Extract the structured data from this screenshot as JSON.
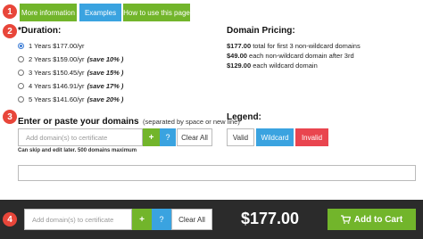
{
  "steps": [
    "1",
    "2",
    "3",
    "4"
  ],
  "top_buttons": {
    "more_info": "More information",
    "examples": "Examples",
    "how_to": "How to use this page"
  },
  "duration": {
    "title": "*Duration:",
    "options": [
      {
        "label": "1 Years $177.00/yr",
        "save": "",
        "selected": true
      },
      {
        "label": "2 Years $159.00/yr",
        "save": "(save 10% )",
        "selected": false
      },
      {
        "label": "3 Years $150.45/yr",
        "save": "(save 15% )",
        "selected": false
      },
      {
        "label": "4 Years $146.91/yr",
        "save": "(save 17% )",
        "selected": false
      },
      {
        "label": "5 Years $141.60/yr",
        "save": "(save 20% )",
        "selected": false
      }
    ]
  },
  "pricing": {
    "title": "Domain Pricing:",
    "lines": [
      {
        "price": "$177.00",
        "text": "total for first 3 non-wildcard domains"
      },
      {
        "price": "$49.00",
        "text": "each non-wildcard domain after 3rd"
      },
      {
        "price": "$129.00",
        "text": "each wildcard domain"
      }
    ]
  },
  "domains": {
    "title": "Enter or paste your domains",
    "hint": "(separated by space or new line)",
    "placeholder": "Add domain(s) to certificate",
    "add": "+",
    "help": "?",
    "clear": "Clear All",
    "note": "Can skip and edit later. 500 domains maximum"
  },
  "legend": {
    "title": "Legend:",
    "valid": "Valid",
    "wildcard": "Wildcard",
    "invalid": "Invalid"
  },
  "footer": {
    "placeholder": "Add domain(s) to certificate",
    "add": "+",
    "help": "?",
    "clear": "Clear All",
    "total": "$177.00",
    "cart": "Add to Cart"
  },
  "colors": {
    "green": "#72b52b",
    "blue": "#3aa3e0",
    "red": "#e9454f",
    "step_badge": "#e8463a",
    "footer_bg": "#2b2b2b"
  }
}
